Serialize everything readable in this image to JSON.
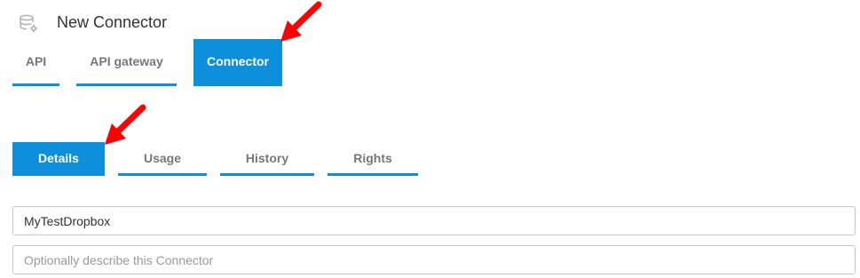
{
  "header": {
    "icon": "database-connector-icon",
    "title": "New Connector"
  },
  "top_tabs": [
    {
      "label": "API",
      "active": false
    },
    {
      "label": "API gateway",
      "active": false
    },
    {
      "label": "Connector",
      "active": true
    }
  ],
  "sub_tabs": [
    {
      "label": "Details",
      "active": true
    },
    {
      "label": "Usage",
      "active": false
    },
    {
      "label": "History",
      "active": false
    },
    {
      "label": "Rights",
      "active": false
    }
  ],
  "form": {
    "name_value": "MyTestDropbox",
    "description_value": "",
    "description_placeholder": "Optionally describe this Connector"
  },
  "colors": {
    "accent": "#0e8fdb",
    "annotation_arrow": "#ff0000",
    "tab_text": "#777777",
    "title_text": "#333333"
  }
}
